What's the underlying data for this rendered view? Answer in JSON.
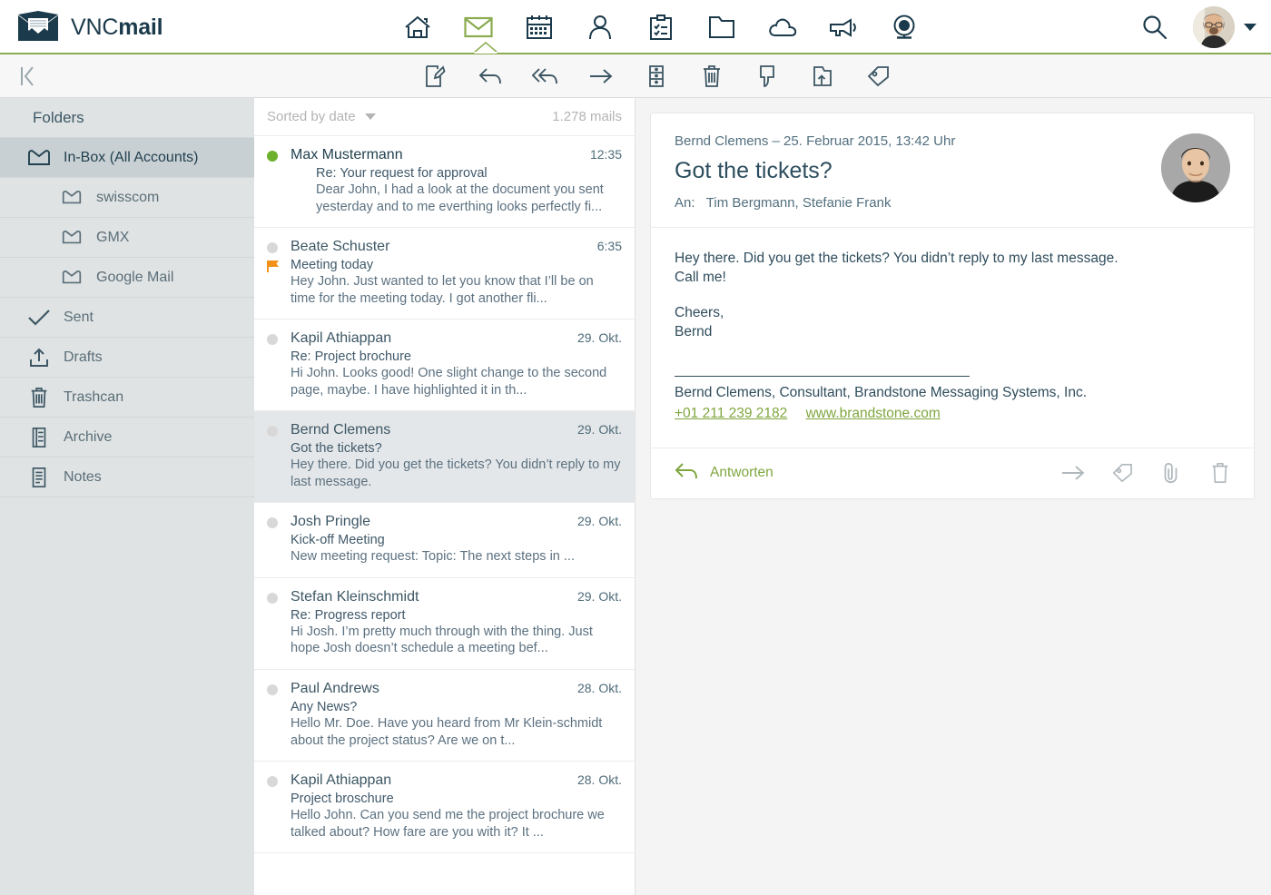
{
  "brand": {
    "name_light": "VNC",
    "name_bold": "mail",
    "logo_icon": "envelope-logo-icon"
  },
  "header": {
    "nav": [
      {
        "id": "home",
        "icon": "home-icon",
        "label": "Home",
        "active": false
      },
      {
        "id": "mail",
        "icon": "mail-icon",
        "label": "Mail",
        "active": true
      },
      {
        "id": "calendar",
        "icon": "calendar-icon",
        "label": "Calendar",
        "active": false
      },
      {
        "id": "contacts",
        "icon": "person-icon",
        "label": "Contacts",
        "active": false
      },
      {
        "id": "tasks",
        "icon": "clipboard-icon",
        "label": "Tasks",
        "active": false
      },
      {
        "id": "files",
        "icon": "folder-icon",
        "label": "Files",
        "active": false
      },
      {
        "id": "cloud",
        "icon": "cloud-icon",
        "label": "Cloud",
        "active": false
      },
      {
        "id": "channels",
        "icon": "megaphone-icon",
        "label": "Channels",
        "active": false
      },
      {
        "id": "meeting",
        "icon": "webcam-icon",
        "label": "Meeting",
        "active": false
      }
    ],
    "search_icon": "search-icon",
    "avatar_icon": "user-avatar",
    "caret_icon": "chevron-down-icon",
    "accent_color": "#8aab4e",
    "brand_color": "#1b3a4b"
  },
  "toolbar": {
    "collapse_icon": "collapse-panel-icon",
    "actions": [
      {
        "id": "compose",
        "icon": "compose-icon",
        "label": "Compose"
      },
      {
        "id": "reply",
        "icon": "reply-icon",
        "label": "Reply"
      },
      {
        "id": "replyall",
        "icon": "reply-all-icon",
        "label": "Reply all"
      },
      {
        "id": "forward",
        "icon": "forward-icon",
        "label": "Forward"
      },
      {
        "id": "archive",
        "icon": "archive-icon",
        "label": "Archive"
      },
      {
        "id": "delete",
        "icon": "trash-icon",
        "label": "Delete"
      },
      {
        "id": "spam",
        "icon": "thumbs-down-icon",
        "label": "Spam"
      },
      {
        "id": "move",
        "icon": "move-folder-icon",
        "label": "Move to folder"
      },
      {
        "id": "tag",
        "icon": "tag-icon",
        "label": "Tag"
      }
    ]
  },
  "sidebar": {
    "title": "Folders",
    "items": [
      {
        "label": "In-Box (All Accounts)",
        "icon": "envelope-icon",
        "active": true,
        "sub": false
      },
      {
        "label": "swisscom",
        "icon": "envelope-icon",
        "active": false,
        "sub": true
      },
      {
        "label": "GMX",
        "icon": "envelope-icon",
        "active": false,
        "sub": true
      },
      {
        "label": "Google Mail",
        "icon": "envelope-icon",
        "active": false,
        "sub": true
      },
      {
        "label": "Sent",
        "icon": "check-icon",
        "active": false,
        "sub": false
      },
      {
        "label": "Drafts",
        "icon": "upload-icon",
        "active": false,
        "sub": false
      },
      {
        "label": "Trashcan",
        "icon": "trash-icon",
        "active": false,
        "sub": false
      },
      {
        "label": "Archive",
        "icon": "archive-icon",
        "active": false,
        "sub": false
      },
      {
        "label": "Notes",
        "icon": "notes-icon",
        "active": false,
        "sub": false
      }
    ]
  },
  "maillist": {
    "sort_label": "Sorted by date",
    "sort_chevron": "chevron-down-icon",
    "count_label": "1.278 mails",
    "rows": [
      {
        "sender": "Max Mustermann",
        "date": "12:35",
        "subject": "Re: Your request for approval",
        "preview": "Dear John, I had a look at the document you sent yesterday and to me everthing looks perfectly fi...",
        "unread": true,
        "flagged": false,
        "selected": false,
        "indent": true
      },
      {
        "sender": "Beate Schuster",
        "date": "6:35",
        "subject": "Meeting today",
        "preview": "Hey John. Just wanted to let you know that I’ll be on time for the meeting today. I got another fli...",
        "unread": false,
        "flagged": true,
        "selected": false,
        "indent": false
      },
      {
        "sender": "Kapil Athiappan",
        "date": "29. Okt.",
        "subject": "Re: Project brochure",
        "preview": "Hi John. Looks good! One slight change to the second page, maybe. I have highlighted it in th...",
        "unread": false,
        "flagged": false,
        "selected": false,
        "indent": false
      },
      {
        "sender": "Bernd Clemens",
        "date": "29. Okt.",
        "subject": "Got the tickets?",
        "preview": "Hey there. Did you get the tickets? You didn’t reply to my last message.",
        "unread": false,
        "flagged": false,
        "selected": true,
        "indent": false
      },
      {
        "sender": "Josh Pringle",
        "date": "29. Okt.",
        "subject": "Kick-off Meeting",
        "preview": "New meeting request: Topic: The next steps in ...",
        "unread": false,
        "flagged": false,
        "selected": false,
        "indent": false
      },
      {
        "sender": "Stefan Kleinschmidt",
        "date": "29. Okt.",
        "subject": "Re: Progress report",
        "preview": "Hi Josh. I’m pretty much through with the thing. Just hope Josh doesn’t schedule a meeting bef...",
        "unread": false,
        "flagged": false,
        "selected": false,
        "indent": false
      },
      {
        "sender": "Paul Andrews",
        "date": "28. Okt.",
        "subject": "Any News?",
        "preview": "Hello Mr. Doe. Have you heard from Mr Klein-schmidt about the project status? Are we on t...",
        "unread": false,
        "flagged": false,
        "selected": false,
        "indent": false
      },
      {
        "sender": "Kapil Athiappan",
        "date": "28. Okt.",
        "subject": "Project broschure",
        "preview": "Hello John. Can you send me the project brochure we talked about? How fare are you with it? It ...",
        "unread": false,
        "flagged": false,
        "selected": false,
        "indent": false
      }
    ]
  },
  "reader": {
    "meta": "Bernd Clemens – 25. Februar 2015, 13:42 Uhr",
    "subject": "Got the tickets?",
    "to_label": "An:",
    "to_value": "Tim Bergmann, Stefanie Frank",
    "avatar_icon": "sender-avatar",
    "body": {
      "line1": "Hey there. Did you get the tickets? You didn’t reply to my last message.",
      "line2": "Call me!",
      "line3": "Cheers,",
      "line4": "Bernd",
      "signature_name": "Bernd Clemens, Consultant, Brandstone Messaging Systems, Inc.",
      "signature_phone": "+01 211 239 2182",
      "signature_web": "www.brandstone.com",
      "link_color": "#7fa63f"
    },
    "footer": {
      "reply_label": "Antworten",
      "reply_icon": "reply-icon",
      "actions": [
        {
          "id": "forward",
          "icon": "forward-icon",
          "label": "Forward"
        },
        {
          "id": "tag",
          "icon": "tag-icon",
          "label": "Tag"
        },
        {
          "id": "attach",
          "icon": "paperclip-icon",
          "label": "Attachment"
        },
        {
          "id": "delete",
          "icon": "trash-icon",
          "label": "Delete"
        }
      ]
    }
  }
}
